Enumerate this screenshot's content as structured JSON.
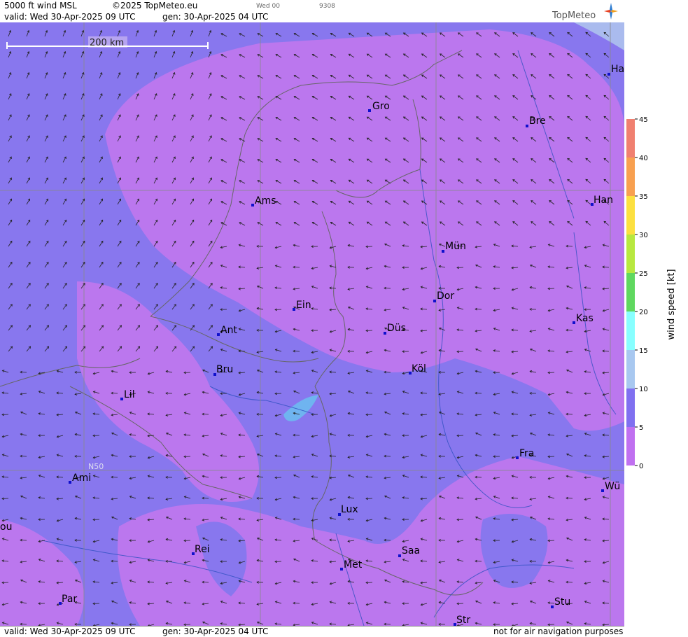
{
  "header": {
    "title": "5000 ft wind MSL",
    "copyright": "©2025 TopMeteo.eu",
    "day_code": "Wed 00",
    "code2": "9308",
    "valid": "valid:  Wed  30-Apr-2025  09 UTC",
    "gen": "gen: 30-Apr-2025 04 UTC",
    "logo_text": "TopMeteo"
  },
  "footer": {
    "valid": "valid:  Wed  30-Apr-2025  09 UTC",
    "gen": "gen: 30-Apr-2025 04 UTC",
    "note": "not for air navigation purposes"
  },
  "map": {
    "scale_label": "200 km",
    "lat_label": "N50",
    "cities": [
      {
        "name": "Gro"
      },
      {
        "name": "Bre"
      },
      {
        "name": "Ha"
      },
      {
        "name": "Ams"
      },
      {
        "name": "Han"
      },
      {
        "name": "Mün"
      },
      {
        "name": "Ein"
      },
      {
        "name": "Dor"
      },
      {
        "name": "Kas"
      },
      {
        "name": "Ant"
      },
      {
        "name": "Düs"
      },
      {
        "name": "Köl"
      },
      {
        "name": "Bru"
      },
      {
        "name": "Lil"
      },
      {
        "name": "Fra"
      },
      {
        "name": "Ami"
      },
      {
        "name": "Wü"
      },
      {
        "name": "Lux"
      },
      {
        "name": "ou"
      },
      {
        "name": "Rei"
      },
      {
        "name": "Saa"
      },
      {
        "name": "Met"
      },
      {
        "name": "Par"
      },
      {
        "name": "Stu"
      },
      {
        "name": "Str"
      }
    ],
    "colors": {
      "band0": "#bb77ee",
      "band5": "#8877ee",
      "band10": "#aabbee",
      "city_marker": "#1010cc"
    }
  },
  "legend": {
    "title": "wind  speed  [kt]",
    "ticks": [
      "45",
      "40",
      "35",
      "30",
      "25",
      "20",
      "15",
      "10",
      "5",
      "0"
    ],
    "colors": [
      "#f08070",
      "#f8a050",
      "#fce040",
      "#b8e840",
      "#60d860",
      "#88ffff",
      "#a8c8f0",
      "#8070f0",
      "#c070f0"
    ]
  }
}
